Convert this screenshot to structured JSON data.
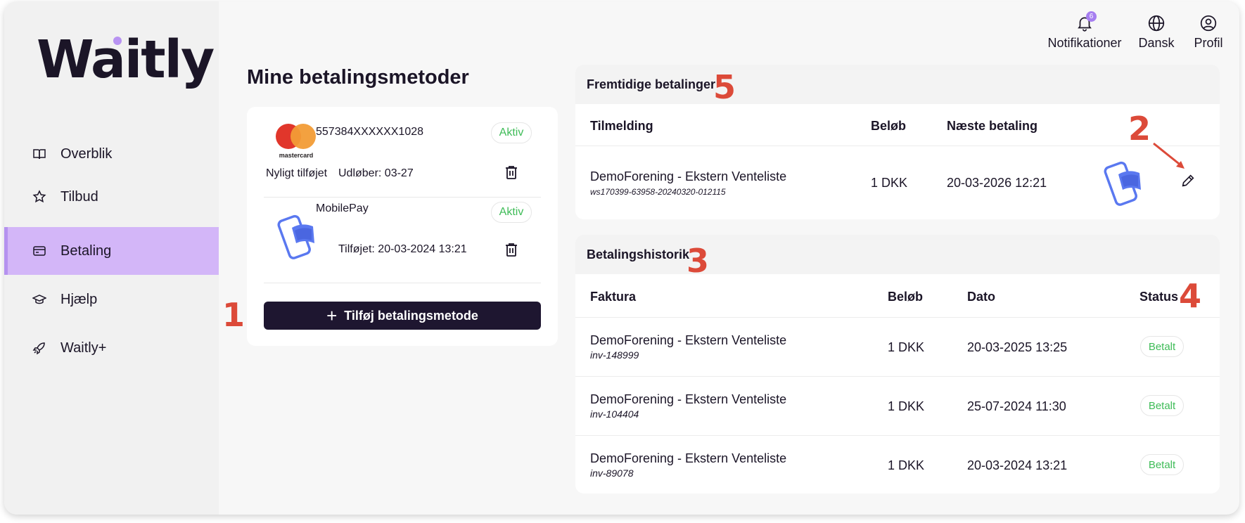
{
  "sidebar": {
    "logo": "Waitly",
    "items": [
      {
        "label": "Overblik",
        "icon": "book-icon"
      },
      {
        "label": "Tilbud",
        "icon": "star-icon"
      },
      {
        "label": "Betaling",
        "icon": "credit-card-icon",
        "active": true
      },
      {
        "label": "Hjælp",
        "icon": "graduation-cap-icon"
      },
      {
        "label": "Waitly+",
        "icon": "rocket-icon"
      }
    ]
  },
  "header": {
    "notifications": {
      "label": "Notifikationer",
      "count": "6"
    },
    "language": {
      "label": "Dansk"
    },
    "profile": {
      "label": "Profil"
    }
  },
  "payment_methods": {
    "title": "Mine betalingsmetoder",
    "cards": [
      {
        "brand": "mastercard",
        "number": "557384XXXXXX1028",
        "note": "Nyligt tilføjet",
        "expiry": "Udløber: 03-27",
        "status": "Aktiv"
      },
      {
        "brand": "MobilePay",
        "number": "MobilePay",
        "added": "Tilføjet: 20-03-2024 13:21",
        "status": "Aktiv"
      }
    ],
    "add_button": "Tilføj betalingsmetode"
  },
  "future_payments": {
    "title": "Fremtidige betalinger",
    "columns": [
      "Tilmelding",
      "Beløb",
      "Næste betaling"
    ],
    "rows": [
      {
        "name": "DemoForening - Ekstern Venteliste",
        "ref": "ws170399-63958-20240320-012115",
        "amount": "1 DKK",
        "next": "20-03-2026 12:21"
      }
    ]
  },
  "history": {
    "title": "Betalingshistorik",
    "columns": [
      "Faktura",
      "Beløb",
      "Dato",
      "Status"
    ],
    "rows": [
      {
        "name": "DemoForening - Ekstern Venteliste",
        "ref": "inv-148999",
        "amount": "1 DKK",
        "date": "20-03-2025 13:25",
        "status": "Betalt"
      },
      {
        "name": "DemoForening - Ekstern Venteliste",
        "ref": "inv-104404",
        "amount": "1 DKK",
        "date": "25-07-2024 11:30",
        "status": "Betalt"
      },
      {
        "name": "DemoForening - Ekstern Venteliste",
        "ref": "inv-89078",
        "amount": "1 DKK",
        "date": "20-03-2024 13:21",
        "status": "Betalt"
      }
    ]
  },
  "annotations": [
    "1",
    "2",
    "3",
    "4",
    "5"
  ],
  "colors": {
    "accent": "#d3b6f8",
    "dark": "#1e1630",
    "success": "#3fbc58",
    "annotation": "#dc4a39"
  }
}
